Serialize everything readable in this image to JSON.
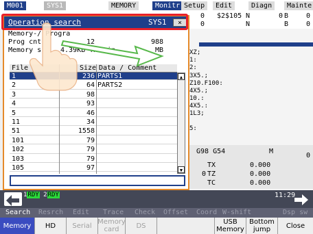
{
  "header": {
    "program": "M001",
    "system": "SYS1",
    "memory_tab": "MEMORY",
    "tabs": [
      "Monitr",
      "Setup",
      "Edit",
      "Diagn",
      "Mainte"
    ],
    "val_row1": [
      "0",
      "$2$105",
      "N",
      "0",
      "B",
      "0"
    ],
    "val_row2": [
      "0",
      "N",
      "B",
      "0"
    ]
  },
  "dialog": {
    "title": "Operation search",
    "system": "SYS1",
    "close": "×",
    "memory_prog": "Memory-/ Progra",
    "prog_cnt_label": "Prog cnt",
    "prog_cnt_value": "12",
    "prog_cnt_total": "988",
    "memory_label": "Memory s",
    "memory_value": "4.39KB",
    "memory_remain_label": "Remain",
    "memory_remain_value": "MB",
    "columns": [
      "File",
      "Size",
      "Data / Comment"
    ],
    "rows": [
      {
        "file": "1",
        "size": "236",
        "comment": "PARTS1"
      },
      {
        "file": "2",
        "size": "64",
        "comment": "PARTS2"
      },
      {
        "file": "3",
        "size": "98",
        "comment": ""
      },
      {
        "file": "4",
        "size": "93",
        "comment": ""
      },
      {
        "file": "5",
        "size": "46",
        "comment": ""
      },
      {
        "file": "11",
        "size": "34",
        "comment": ""
      },
      {
        "file": "51",
        "size": "1558",
        "comment": ""
      },
      {
        "file": "101",
        "size": "79",
        "comment": ""
      },
      {
        "file": "102",
        "size": "79",
        "comment": ""
      },
      {
        "file": "103",
        "size": "79",
        "comment": ""
      },
      {
        "file": "105",
        "size": "97",
        "comment": ""
      }
    ],
    "search_value": ""
  },
  "program_view": {
    "lines": [
      "XZ;",
      "1:",
      "2:",
      "3X5.;",
      "Z10.F100:",
      "4X5.;",
      "10.:",
      "4X5.:",
      "1L3;",
      "5:"
    ],
    "gcode": "G98 G54",
    "m_label": "M",
    "m_value": "0",
    "tx_label": "TX",
    "tx_value": "0.000",
    "tz_label": "TZ",
    "tz_prefix": "0",
    "tz_value": "0.000",
    "tc_label": "TC",
    "tc_value": "0.000"
  },
  "status": {
    "rdy1": "RDY",
    "rdy2": "RDY",
    "rdy1_num": "1",
    "rdy2_num": "2",
    "time": "11:29"
  },
  "menu1": [
    "Search",
    "Resrch",
    "Edit",
    "Trace",
    "Check",
    "Offset",
    "Coord",
    "W-shift",
    "Dsp sw"
  ],
  "menu2": [
    {
      "label": "Memory",
      "active": true,
      "gray": false
    },
    {
      "label": "HD",
      "active": false,
      "gray": false
    },
    {
      "label": "Serial",
      "active": false,
      "gray": true
    },
    {
      "label": "Memory card",
      "active": false,
      "gray": true
    },
    {
      "label": "DS",
      "active": false,
      "gray": true
    },
    {
      "label": "",
      "active": false,
      "gray": true
    },
    {
      "label": "USB Memory",
      "active": false,
      "gray": false
    },
    {
      "label": "Bottom jump",
      "active": false,
      "gray": false
    },
    {
      "label": "Close",
      "active": false,
      "gray": false
    }
  ],
  "colors": {
    "title_bar": "#1f3f8a",
    "highlight": "#e8202a",
    "dialog_border": "#e58a2a",
    "status_bar": "#434756",
    "active_key": "#3a4cc0",
    "rdy_green": "#2bd93a"
  },
  "icons": [
    "back-arrow-icon",
    "forward-arrow-icon",
    "pointing-hand-icon",
    "annotation-arrow-icon"
  ]
}
